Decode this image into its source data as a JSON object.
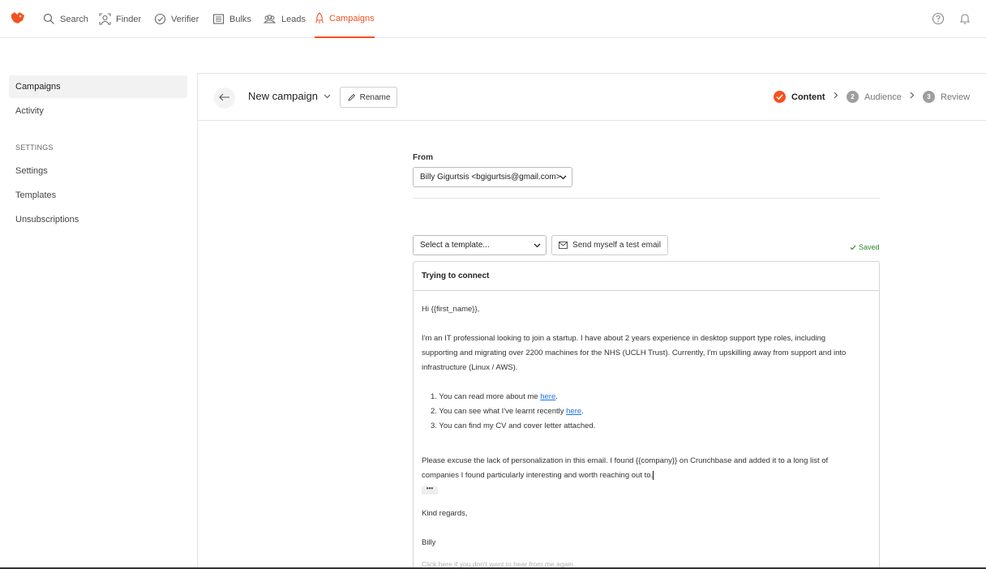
{
  "nav": {
    "items": [
      {
        "label": "Search",
        "icon": "search-icon"
      },
      {
        "label": "Finder",
        "icon": "finder-icon"
      },
      {
        "label": "Verifier",
        "icon": "verifier-icon"
      },
      {
        "label": "Bulks",
        "icon": "bulks-icon"
      },
      {
        "label": "Leads",
        "icon": "leads-icon"
      },
      {
        "label": "Campaigns",
        "icon": "campaigns-icon"
      }
    ],
    "active": "Campaigns"
  },
  "sidebar": {
    "items": [
      {
        "label": "Campaigns"
      },
      {
        "label": "Activity"
      }
    ],
    "section_title": "SETTINGS",
    "settings_items": [
      {
        "label": "Settings"
      },
      {
        "label": "Templates"
      },
      {
        "label": "Unsubscriptions"
      }
    ]
  },
  "header": {
    "campaign_name": "New campaign",
    "rename_label": "Rename",
    "steps": [
      {
        "num": "1",
        "label": "Content",
        "state": "done"
      },
      {
        "num": "2",
        "label": "Audience",
        "state": "pending"
      },
      {
        "num": "3",
        "label": "Review",
        "state": "pending"
      }
    ]
  },
  "form": {
    "from_label": "From",
    "from_value": "Billy Gigurtsis <bgigurtsis@gmail.com>",
    "template_placeholder": "Select a template...",
    "test_email_label": "Send myself a test email",
    "saved_label": "Saved"
  },
  "email": {
    "subject": "Trying to connect",
    "greeting": "Hi {{first_name}},",
    "para1_line1": "I'm an IT professional looking to join a startup.  I have about 2 years experience  in desktop support type roles, including",
    "para1_line2": "supporting and migrating over 2200 machines for the NHS (UCLH Trust). Currently, I'm upskilling away from support and into",
    "para1_line3": "infrastructure (Linux / AWS).",
    "list": [
      {
        "prefix": "1. You can read more about me ",
        "link": "here",
        "suffix": "."
      },
      {
        "prefix": "2. You can see what I've learnt recently ",
        "link": "here",
        "suffix": "."
      },
      {
        "prefix": "3. You can find my CV and cover letter attached.",
        "link": "",
        "suffix": ""
      }
    ],
    "para2_line1": "Please excuse the lack of personalization in this email. I found {{company}} on Crunchbase and added it to a long list of",
    "para2_line2": "companies I found particularly interesting and worth reaching out to.",
    "ellipsis": "•••",
    "closing": "Kind regards,",
    "signature": "Billy",
    "unsubscribe": "Click here if you don't want to hear from me again."
  },
  "colors": {
    "accent": "#f4511e",
    "saved_green": "#2e8b2e",
    "link": "#1a73e8"
  }
}
